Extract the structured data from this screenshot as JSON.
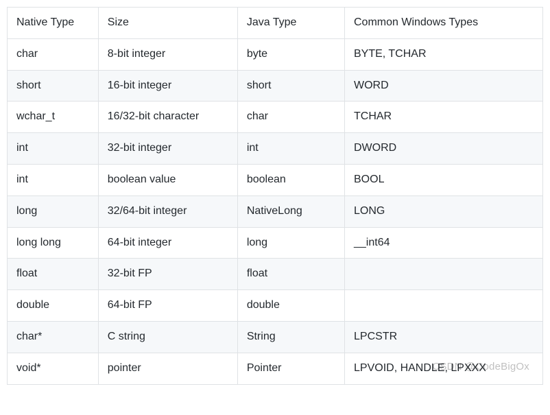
{
  "table": {
    "headers": {
      "native": "Native Type",
      "size": "Size",
      "java": "Java Type",
      "windows": "Common Windows Types"
    },
    "rows": [
      {
        "native": "char",
        "size": "8-bit integer",
        "java": "byte",
        "windows": "BYTE, TCHAR"
      },
      {
        "native": "short",
        "size": "16-bit integer",
        "java": "short",
        "windows": "WORD"
      },
      {
        "native": "wchar_t",
        "size": "16/32-bit character",
        "java": "char",
        "windows": "TCHAR"
      },
      {
        "native": "int",
        "size": "32-bit integer",
        "java": "int",
        "windows": "DWORD"
      },
      {
        "native": "int",
        "size": "boolean value",
        "java": "boolean",
        "windows": "BOOL"
      },
      {
        "native": "long",
        "size": "32/64-bit integer",
        "java": "NativeLong",
        "windows": "LONG"
      },
      {
        "native": "long long",
        "size": "64-bit integer",
        "java": "long",
        "windows": "__int64"
      },
      {
        "native": "float",
        "size": "32-bit FP",
        "java": "float",
        "windows": ""
      },
      {
        "native": "double",
        "size": "64-bit FP",
        "java": "double",
        "windows": ""
      },
      {
        "native": "char*",
        "size": "C string",
        "java": "String",
        "windows": "LPCSTR"
      },
      {
        "native": "void*",
        "size": "pointer",
        "java": "Pointer",
        "windows": "LPVOID, HANDLE, LPXXX"
      }
    ]
  },
  "watermark": "CSDN @CodeBigOx"
}
